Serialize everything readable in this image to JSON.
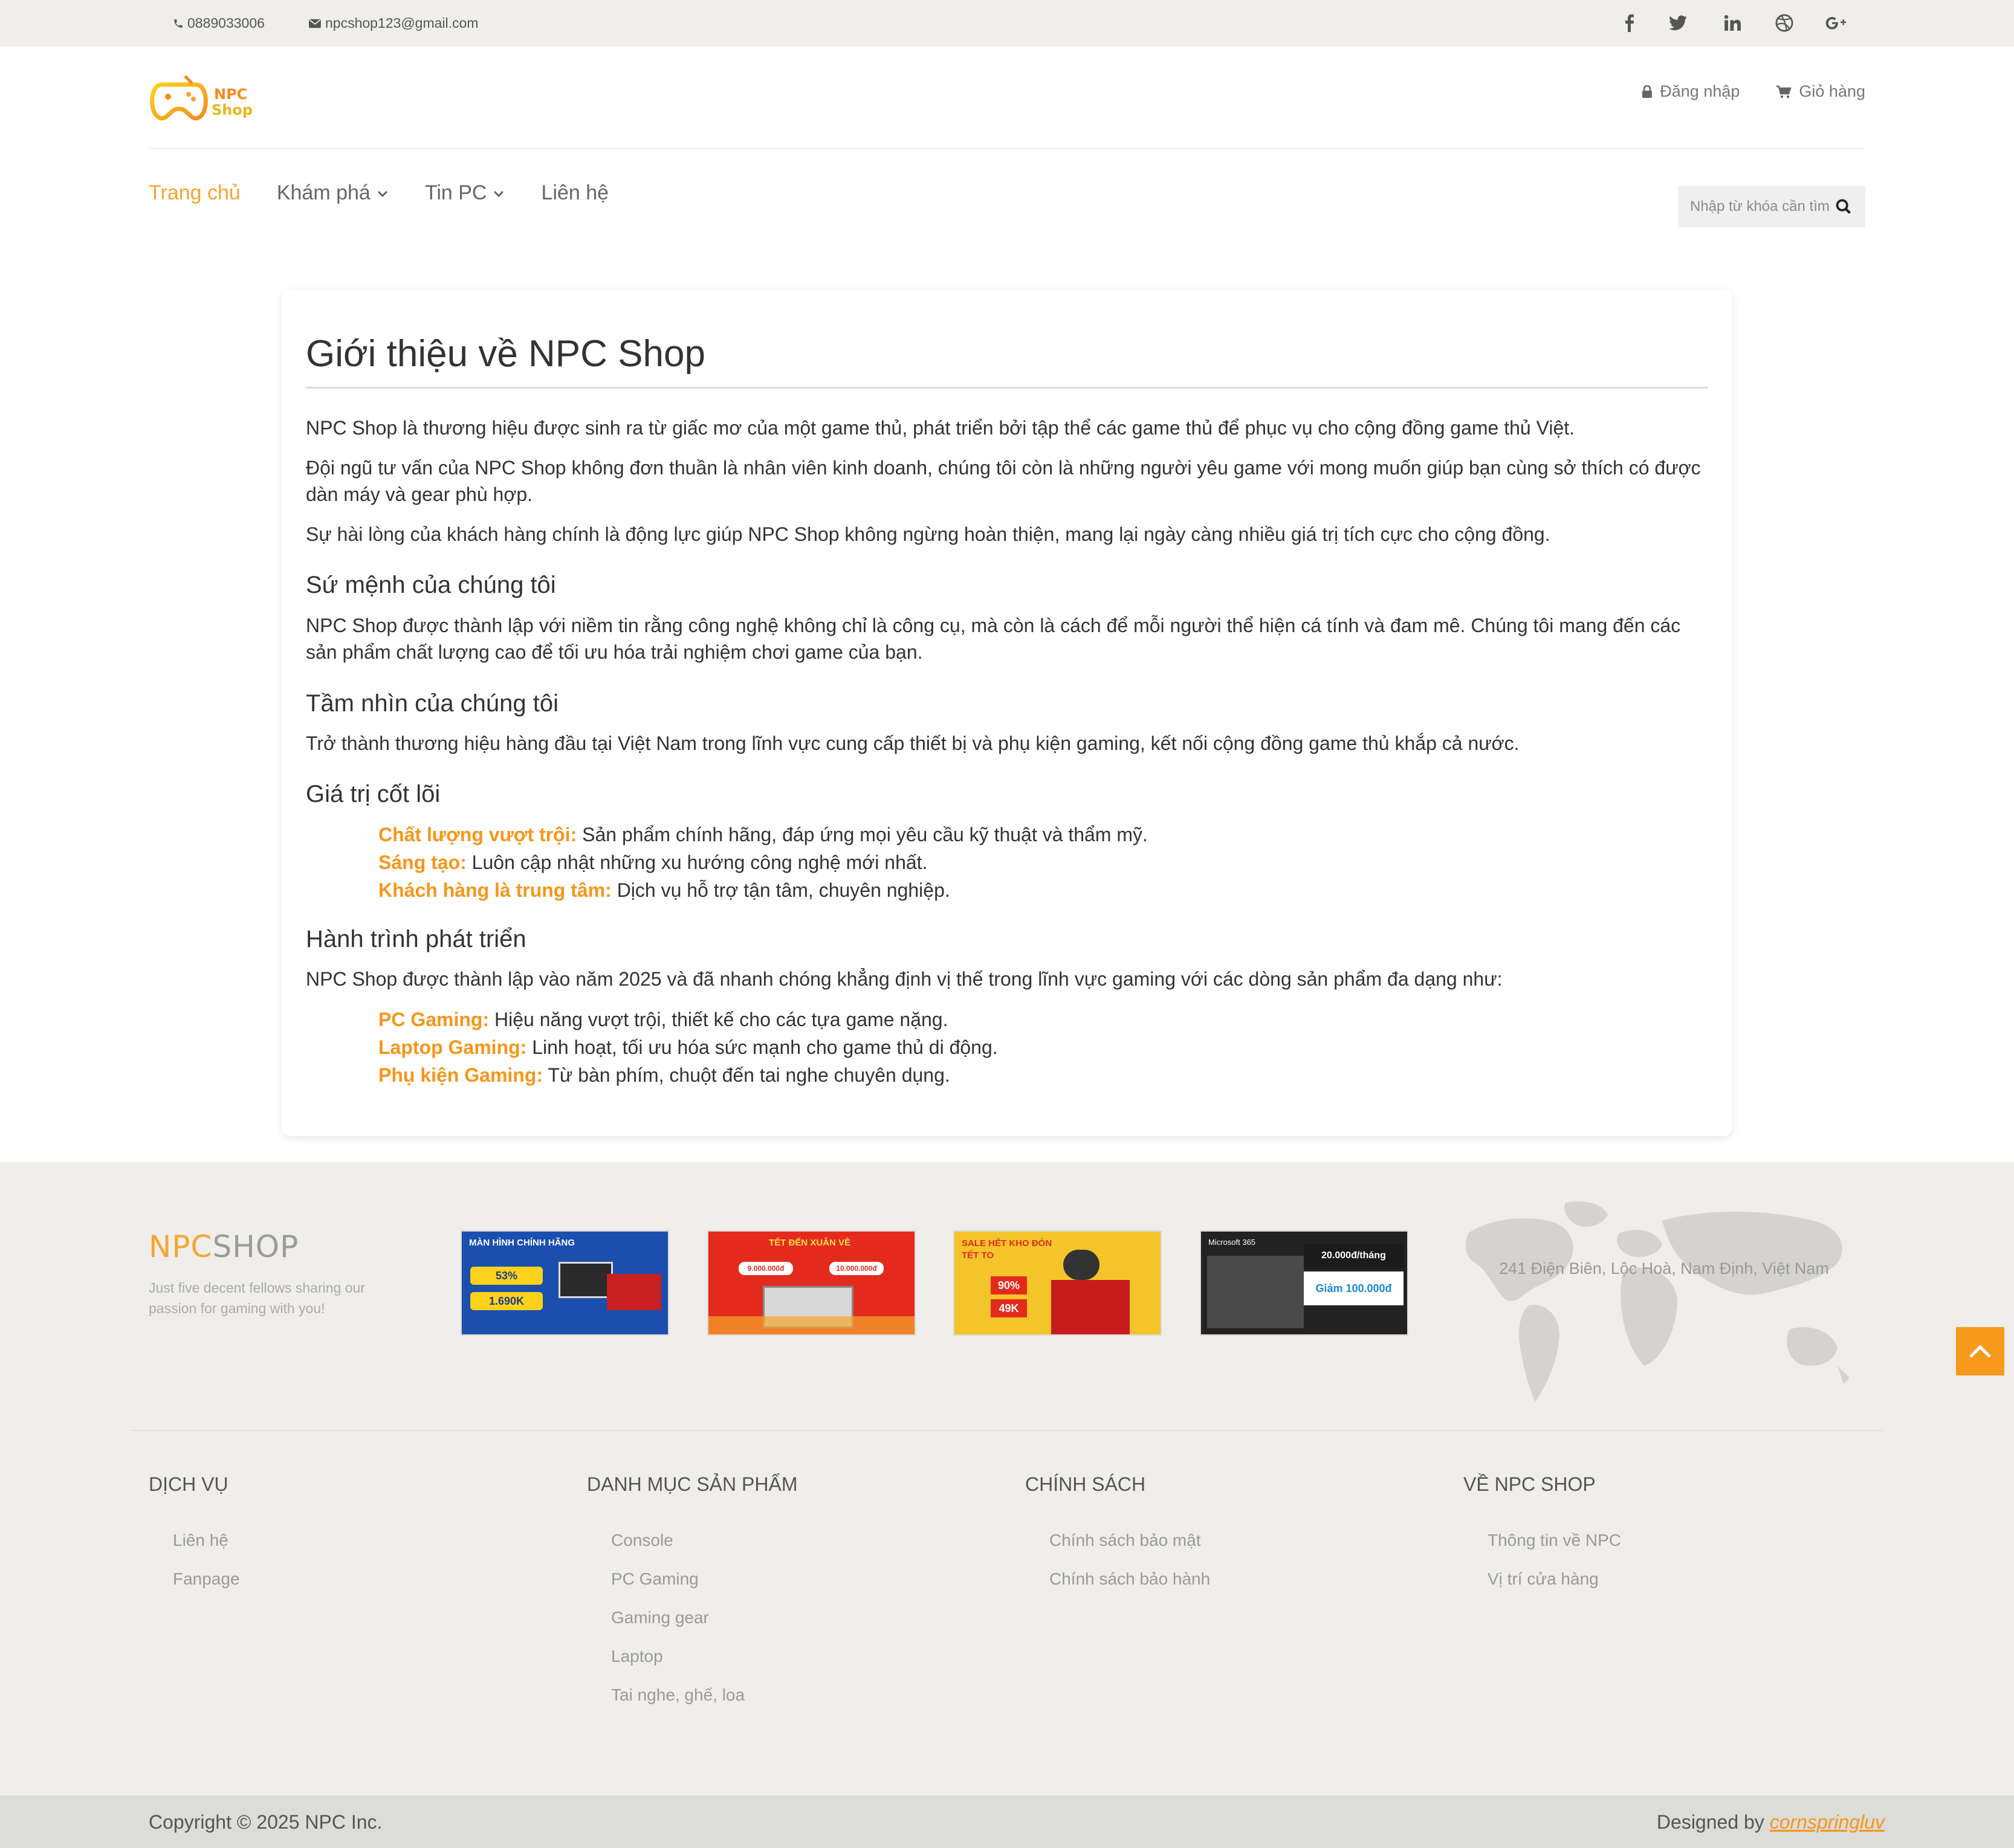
{
  "topbar": {
    "phone": "0889033006",
    "email": "npcshop123@gmail.com",
    "social_icons": [
      "facebook-icon",
      "twitter-icon",
      "linkedin-icon",
      "dribbble-icon",
      "google-plus-icon"
    ]
  },
  "header": {
    "logo_text_line1": "NPC",
    "logo_text_line2": "Shop",
    "login_label": "Đăng nhập",
    "cart_label": "Giỏ hàng"
  },
  "nav": {
    "items": [
      {
        "label": "Trang chủ",
        "active": true,
        "has_dropdown": false
      },
      {
        "label": "Khám phá",
        "active": false,
        "has_dropdown": true
      },
      {
        "label": "Tin PC",
        "active": false,
        "has_dropdown": true
      },
      {
        "label": "Liên hệ",
        "active": false,
        "has_dropdown": false
      }
    ],
    "search_placeholder": "Nhập từ khóa cần tìm"
  },
  "content": {
    "title": "Giới thiệu về NPC Shop",
    "intro": [
      "NPC Shop là thương hiệu được sinh ra từ giấc mơ của một game thủ, phát triển bởi tập thể các game thủ để phục vụ cho cộng đồng game thủ Việt.",
      "Đội ngũ tư vấn của NPC Shop không đơn thuần là nhân viên kinh doanh, chúng tôi còn là những người yêu game với mong muốn giúp bạn cùng sở thích có được dàn máy và gear phù hợp.",
      "Sự hài lòng của khách hàng chính là động lực giúp NPC Shop không ngừng hoàn thiện, mang lại ngày càng nhiều giá trị tích cực cho cộng đồng."
    ],
    "mission_title": "Sứ mệnh của chúng tôi",
    "mission_text": "NPC Shop được thành lập với niềm tin rằng công nghệ không chỉ là công cụ, mà còn là cách để mỗi người thể hiện cá tính và đam mê. Chúng tôi mang đến các sản phẩm chất lượng cao để tối ưu hóa trải nghiệm chơi game của bạn.",
    "vision_title": "Tầm nhìn của chúng tôi",
    "vision_text": "Trở thành thương hiệu hàng đầu tại Việt Nam trong lĩnh vực cung cấp thiết bị và phụ kiện gaming, kết nối cộng đồng game thủ khắp cả nước.",
    "values_title": "Giá trị cốt lõi",
    "values": [
      {
        "key": "Chất lượng vượt trội:",
        "text": " Sản phẩm chính hãng, đáp ứng mọi yêu cầu kỹ thuật và thẩm mỹ."
      },
      {
        "key": "Sáng tạo:",
        "text": " Luôn cập nhật những xu hướng công nghệ mới nhất."
      },
      {
        "key": "Khách hàng là trung tâm:",
        "text": " Dịch vụ hỗ trợ tận tâm, chuyên nghiệp."
      }
    ],
    "journey_title": "Hành trình phát triển",
    "journey_text": "NPC Shop được thành lập vào năm 2025 và đã nhanh chóng khẳng định vị thế trong lĩnh vực gaming với các dòng sản phẩm đa dạng như:",
    "products": [
      {
        "key": "PC Gaming:",
        "text": " Hiệu năng vượt trội, thiết kế cho các tựa game nặng."
      },
      {
        "key": "Laptop Gaming:",
        "text": " Linh hoạt, tối ưu hóa sức mạnh cho game thủ di động."
      },
      {
        "key": "Phụ kiện Gaming:",
        "text": " Từ bàn phím, chuột đến tai nghe chuyên dụng."
      }
    ]
  },
  "footer": {
    "brand_a": "NPC",
    "brand_b": "SHOP",
    "tagline": "Just five decent fellows sharing our passion for gaming with you!",
    "banners": [
      {
        "title": "MÀN HÌNH CHÍNH HÃNG",
        "line1": "53%",
        "line2": "1.690K",
        "bg": "#1b4fae"
      },
      {
        "title": "TẾT ĐẾN XUÂN VỀ",
        "line1": "9.000.000đ",
        "line2": "10.000.000đ",
        "bg": "#e42a1d"
      },
      {
        "title": "SALE HẾT KHO ĐÓN TẾT TO",
        "line1": "90%",
        "line2": "49K",
        "bg": "#f4c52a"
      },
      {
        "title": "Microsoft 365",
        "line1": "20.000đ/tháng",
        "line2": "Giảm 100.000đ",
        "bg": "#222222"
      }
    ],
    "address": "241 Điện Biên, Lộc Hoà, Nam Định, Việt Nam",
    "columns": [
      {
        "heading": "DỊCH VỤ",
        "links": [
          "Liên hệ",
          "Fanpage"
        ]
      },
      {
        "heading": "DANH MỤC SẢN PHẨM",
        "links": [
          "Console",
          "PC Gaming",
          "Gaming gear",
          "Laptop",
          "Tai nghe, ghế, loa"
        ]
      },
      {
        "heading": "CHÍNH SÁCH",
        "links": [
          "Chính sách bảo mật",
          "Chính sách bảo hành"
        ]
      },
      {
        "heading": "VỀ NPC SHOP",
        "links": [
          "Thông tin về NPC",
          "Vị trí cửa hàng"
        ]
      }
    ],
    "copyright": "Copyright © 2025 NPC Inc.",
    "designed_by": "Designed by ",
    "designer": "cornspringluv"
  },
  "colors": {
    "accent": "#f6a532",
    "keyword": "#f6961b",
    "topbar_bg": "#efeeea",
    "footer_bg": "#efeeea",
    "bottombar_bg": "#dcdcd8"
  }
}
